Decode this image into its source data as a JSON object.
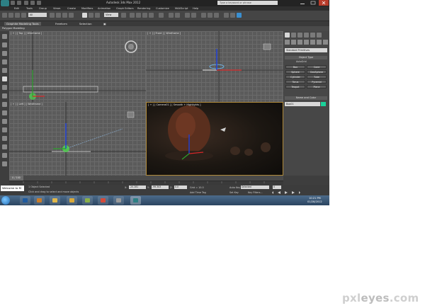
{
  "window": {
    "title": "Autodesk 3ds Max 2012",
    "search_placeholder": "Type a keyword or phrase"
  },
  "menu": [
    "Edit",
    "Tools",
    "Group",
    "Views",
    "Create",
    "Modifiers",
    "Animation",
    "Graph Editors",
    "Rendering",
    "Customize",
    "MAXScript",
    "Help"
  ],
  "toolbar": {
    "selection_filter": "All",
    "reference_coord": "View"
  },
  "ribbon": {
    "tabs": [
      "Graphite Modeling Tools",
      "Freeform",
      "Selection"
    ],
    "panel": "Polygon Modeling"
  },
  "viewports": {
    "top": "[ + ] [ Top ] [ Wireframe ]",
    "front": "[ + ] [ Front ] [ Wireframe ]",
    "left": "[ + ] [ Left ] [ Wireframe ]",
    "camera": "[ + ] [ Camera01 ] [ Smooth + Highlights ]"
  },
  "command_panel": {
    "category": "Standard Primitives",
    "object_type_title": "Object Type",
    "autogrid": "AutoGrid",
    "buttons": [
      "Box",
      "Cone",
      "Sphere",
      "GeoSphere",
      "Cylinder",
      "Tube",
      "Torus",
      "Pyramid",
      "Teapot",
      "Plane"
    ],
    "name_color_title": "Name and Color",
    "name_value": "Box01",
    "accent_color": "#1ad29a"
  },
  "timeline": {
    "frame": "0 / 100"
  },
  "status": {
    "welcome": "Welcome to M",
    "objects_selected": "1 Object Selected",
    "prompt": "Click and drag to select and move objects",
    "x_label": "X:",
    "x": "-20.281",
    "y_label": "Y:",
    "y": "-99.303",
    "z_label": "Z:",
    "z": "0.0",
    "grid": "Grid = 10.0",
    "add_time_tag": "Add Time Tag",
    "auto_key": "Auto Key",
    "selected": "Selected",
    "set_key": "Set Key",
    "key_filters": "Key Filters...",
    "current_frame": "0"
  },
  "taskbar": {
    "time": "10:21 PM",
    "date": "01/28/2012"
  },
  "watermark": {
    "text_a": "pxl",
    "text_b": "eyes",
    "text_c": ".com"
  }
}
